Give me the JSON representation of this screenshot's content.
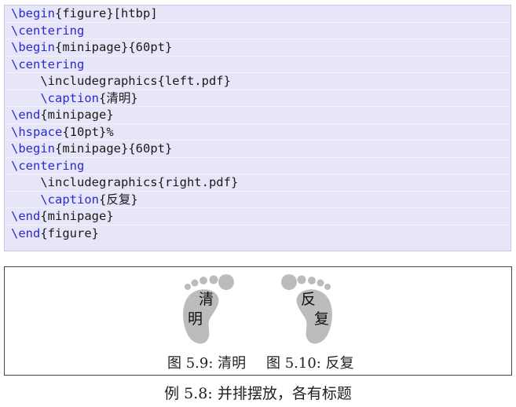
{
  "code": {
    "lines": [
      {
        "kw": "\\begin",
        "rest": "{figure}[htbp]"
      },
      {
        "kw": "\\centering",
        "rest": ""
      },
      {
        "kw": "\\begin",
        "rest": "{minipage}{60pt}"
      },
      {
        "kw": "\\centering",
        "rest": ""
      },
      {
        "kw": "",
        "rest": "    \\includegraphics{left.pdf}"
      },
      {
        "kw": "    \\caption",
        "rest": "{清明}"
      },
      {
        "kw": "\\end",
        "rest": "{minipage}"
      },
      {
        "kw": "\\hspace",
        "rest": "{10pt}%"
      },
      {
        "kw": "\\begin",
        "rest": "{minipage}{60pt}"
      },
      {
        "kw": "\\centering",
        "rest": ""
      },
      {
        "kw": "",
        "rest": "    \\includegraphics{right.pdf}"
      },
      {
        "kw": "    \\caption",
        "rest": "{反复}"
      },
      {
        "kw": "\\end",
        "rest": "{minipage}"
      },
      {
        "kw": "\\end",
        "rest": "{figure}"
      }
    ]
  },
  "figure": {
    "left_foot": {
      "char1": "清",
      "char2": "明"
    },
    "right_foot": {
      "char1": "反",
      "char2": "复"
    },
    "caption_left": "图 5.9: 清明",
    "caption_right": "图 5.10: 反复",
    "foot_color": "#bcbcbc"
  },
  "example_caption": "例 5.8: 并排摆放，各有标题"
}
